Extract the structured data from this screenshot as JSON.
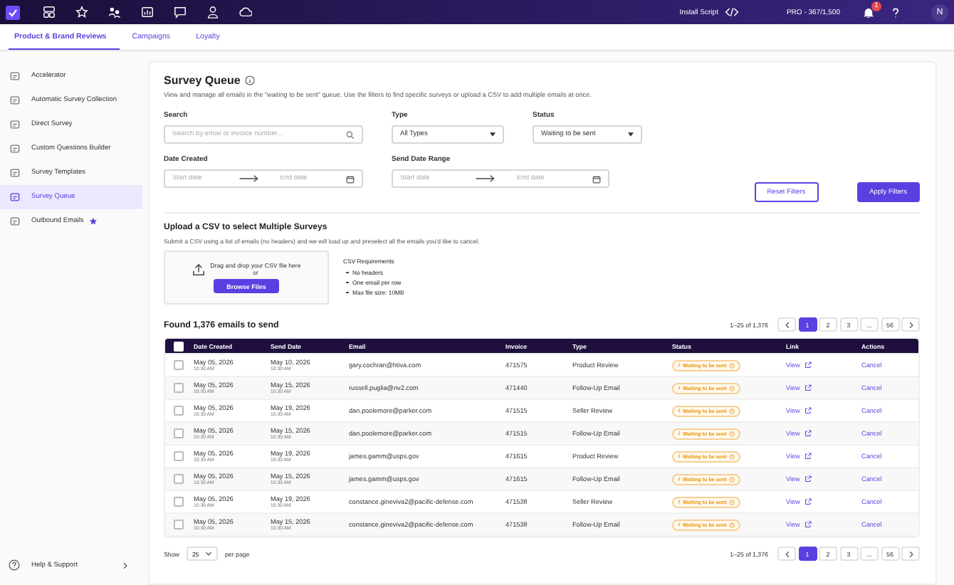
{
  "top_bar": {
    "install_script": "Install Script",
    "plan": "PRO - 367/1,500",
    "notification_count": "1",
    "avatar": "N"
  },
  "tabs": [
    {
      "label": "Product & Brand Reviews",
      "selected": true
    },
    {
      "label": "Campaigns",
      "selected": false
    },
    {
      "label": "Loyalty",
      "selected": false
    }
  ],
  "sidebar": {
    "items": [
      {
        "label": "Accelerator",
        "selected": false
      },
      {
        "label": "Automatic Survey Collection",
        "selected": false
      },
      {
        "label": "Direct Survey",
        "selected": false
      },
      {
        "label": "Custom Questions Builder",
        "selected": false
      },
      {
        "label": "Survey Templates",
        "selected": false
      },
      {
        "label": "Survey Queue",
        "selected": true
      },
      {
        "label": "Outbound Emails",
        "selected": false,
        "starred": true
      }
    ],
    "help": "Help & Support"
  },
  "page": {
    "title": "Survey Queue",
    "description": "View and manage all emails in the \"waiting to be sent\" queue. Use the filters to find specific surveys or upload a CSV to add multiple emails at once."
  },
  "filters": {
    "search": {
      "label": "Search",
      "placeholder": "Search by email or invoice number..."
    },
    "type": {
      "label": "Type",
      "value": "All Types"
    },
    "status": {
      "label": "Status",
      "value": "Waiting to be sent"
    },
    "date_created": {
      "label": "Date Created",
      "start_placeholder": "Start date",
      "end_placeholder": "End date"
    },
    "send_date_range": {
      "label": "Send Date Range",
      "start_placeholder": "Start date",
      "end_placeholder": "End date"
    },
    "buttons": [
      "Reset Filters",
      "Apply Filters"
    ]
  },
  "upload": {
    "title": "Upload a CSV to select Multiple Surveys",
    "description": "Submit a CSV using a list of emails (no headers) and we will load up and preselect all the emails you'd like to cancel.",
    "drop_text": "Drag and drop your CSV file here",
    "or": "or",
    "button": "Browse Files",
    "requirements_title": "CSV Requirements",
    "requirements": [
      "No headers",
      "One email per row",
      "Max file size: 10MB"
    ]
  },
  "results": {
    "title": "Found 1,376 emails to send",
    "range": "1–25 of 1,376",
    "pages": [
      {
        "label": "1",
        "selected": true
      },
      {
        "label": "2",
        "selected": false
      },
      {
        "label": "3",
        "selected": false
      },
      {
        "label": "...",
        "selected": false
      },
      {
        "label": "56",
        "selected": false
      }
    ]
  },
  "table": {
    "select_all_checked": false,
    "columns": [
      "Date Created",
      "Send Date",
      "Email",
      "Invoice",
      "Type",
      "Status",
      "Link",
      "Actions"
    ],
    "rows": [
      {
        "checked": false,
        "date_created": "May 05, 2026",
        "created_time": "10:30 AM",
        "send_date": "May 10, 2026",
        "send_time": "10:30 AM",
        "email": "gary.cochran@htiva.com",
        "invoice": "471575",
        "type": "Product Review",
        "status": "Waiting to be sent",
        "link": "View",
        "action": "Cancel"
      },
      {
        "checked": false,
        "date_created": "May 05, 2026",
        "created_time": "10:30 AM",
        "send_date": "May 15, 2026",
        "send_time": "10:30 AM",
        "email": "russell.puglia@nv2.com",
        "invoice": "471440",
        "type": "Follow-Up Email",
        "status": "Waiting to be sent",
        "link": "View",
        "action": "Cancel"
      },
      {
        "checked": false,
        "date_created": "May 05, 2026",
        "created_time": "10:30 AM",
        "send_date": "May 19, 2026",
        "send_time": "10:30 AM",
        "email": "dan.poolemore@parker.com",
        "invoice": "471515",
        "type": "Seller Review",
        "status": "Waiting to be sent",
        "link": "View",
        "action": "Cancel"
      },
      {
        "checked": false,
        "date_created": "May 05, 2026",
        "created_time": "10:30 AM",
        "send_date": "May 15, 2026",
        "send_time": "10:30 AM",
        "email": "dan.poolemore@parker.com",
        "invoice": "471515",
        "type": "Follow-Up Email",
        "status": "Waiting to be sent",
        "link": "View",
        "action": "Cancel"
      },
      {
        "checked": false,
        "date_created": "May 05, 2026",
        "created_time": "10:30 AM",
        "send_date": "May 19, 2026",
        "send_time": "10:30 AM",
        "email": "james.gamm@usps.gov",
        "invoice": "471615",
        "type": "Product Review",
        "status": "Waiting to be sent",
        "link": "View",
        "action": "Cancel"
      },
      {
        "checked": false,
        "date_created": "May 05, 2026",
        "created_time": "10:30 AM",
        "send_date": "May 15, 2026",
        "send_time": "10:30 AM",
        "email": "james.gamm@usps.gov",
        "invoice": "471615",
        "type": "Follow-Up Email",
        "status": "Waiting to be sent",
        "link": "View",
        "action": "Cancel"
      },
      {
        "checked": false,
        "date_created": "May 05, 2026",
        "created_time": "10:30 AM",
        "send_date": "May 19, 2026",
        "send_time": "10:30 AM",
        "email": "constance.gineviva2@pacific-defense.com",
        "invoice": "471538",
        "type": "Seller Review",
        "status": "Waiting to be sent",
        "link": "View",
        "action": "Cancel"
      },
      {
        "checked": false,
        "date_created": "May 05, 2026",
        "created_time": "10:30 AM",
        "send_date": "May 15, 2026",
        "send_time": "10:30 AM",
        "email": "constance.gineviva2@pacific-defense.com",
        "invoice": "471538",
        "type": "Follow-Up Email",
        "status": "Waiting to be sent",
        "link": "View",
        "action": "Cancel"
      }
    ]
  },
  "footer": {
    "show": "Show",
    "page_size": "25",
    "per_page": "per page",
    "range": "1–25 of 1,376",
    "pages": [
      {
        "label": "1",
        "selected": true
      },
      {
        "label": "2",
        "selected": false
      },
      {
        "label": "3",
        "selected": false
      },
      {
        "label": "...",
        "selected": false
      },
      {
        "label": "56",
        "selected": false
      }
    ]
  }
}
